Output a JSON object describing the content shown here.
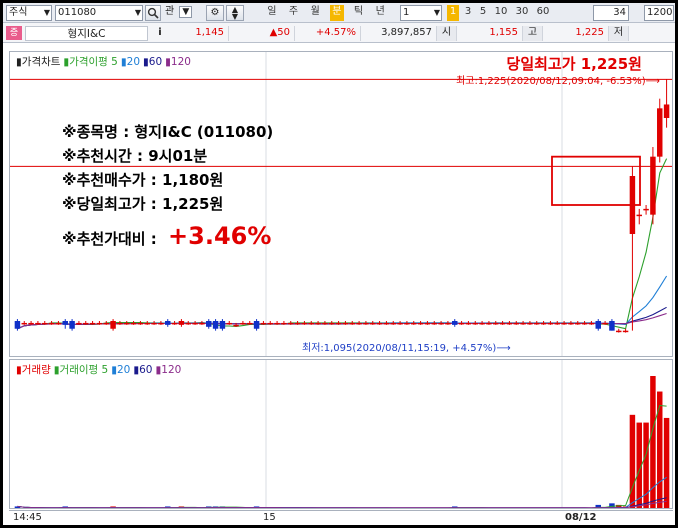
{
  "toolbar": {
    "market_select": "주식",
    "code_input": "011080",
    "search_icon": "search-icon",
    "gwan_button": "관",
    "period_buttons": [
      "일",
      "주",
      "월",
      "분",
      "틱",
      "년"
    ],
    "active_period": "분",
    "unit_value": "1",
    "interval_buttons": [
      "1",
      "3",
      "5",
      "10",
      "30",
      "60"
    ],
    "active_interval": "1",
    "count_value": "34",
    "range_value": "1200"
  },
  "quote": {
    "badge": "증",
    "name": "형지I&C",
    "info_button": "i",
    "price": "1,145",
    "change": "▲50",
    "change_rate": "+4.57%",
    "volume": "3,897,857",
    "open_label": "시",
    "open_value": "1,155",
    "high_label": "고",
    "high_value": "1,225",
    "low_label": "저"
  },
  "price_panel": {
    "legend": [
      {
        "text": "가격차트",
        "color": "#222222"
      },
      {
        "text": "가격이평 5",
        "color": "#2ca02c"
      },
      {
        "text": "20",
        "color": "#1f7fd6"
      },
      {
        "text": "60",
        "color": "#1a1a8c"
      },
      {
        "text": "120",
        "color": "#8b2c8b"
      }
    ],
    "headline": "당일최고가 1,225원",
    "high_marker": "최고:1,225(2020/08/12,09:04, -6.53%)⟶",
    "low_marker": "최저:1,095(2020/08/11,15:19, +4.57%)⟶",
    "info_lines": [
      "※종목명 : 형지I&C (011080)",
      "※추천시간 : 9시01분",
      "※추천매수가 : 1,180원",
      "※당일최고가 : 1,225원"
    ],
    "compare_label": "※추천가대비 :",
    "compare_value": "+3.46%"
  },
  "volume_panel": {
    "legend": [
      {
        "text": "거래량",
        "color": "#e00000"
      },
      {
        "text": "거래이평 5",
        "color": "#2ca02c"
      },
      {
        "text": "20",
        "color": "#1f7fd6"
      },
      {
        "text": "60",
        "color": "#1a1a8c"
      },
      {
        "text": "120",
        "color": "#8b2c8b"
      }
    ]
  },
  "x_axis": {
    "labels": [
      "14:45",
      "15",
      "08/12"
    ]
  },
  "chart_data": {
    "type": "candlestick",
    "candles": [
      {
        "o": 1100,
        "c": 1096,
        "h": 1101,
        "l": 1095
      },
      {
        "o": 1099,
        "c": 1099,
        "h": 1100,
        "l": 1098
      },
      {
        "o": 1099,
        "c": 1099,
        "h": 1100,
        "l": 1098
      },
      {
        "o": 1099,
        "c": 1099,
        "h": 1100,
        "l": 1098
      },
      {
        "o": 1099,
        "c": 1099,
        "h": 1100,
        "l": 1098
      },
      {
        "o": 1099,
        "c": 1099,
        "h": 1100,
        "l": 1098
      },
      {
        "o": 1099,
        "c": 1099,
        "h": 1100,
        "l": 1098
      },
      {
        "o": 1100,
        "c": 1098,
        "h": 1101,
        "l": 1096
      },
      {
        "o": 1100,
        "c": 1096,
        "h": 1101,
        "l": 1095
      },
      {
        "o": 1099,
        "c": 1099,
        "h": 1100,
        "l": 1098
      },
      {
        "o": 1099,
        "c": 1099,
        "h": 1100,
        "l": 1098
      },
      {
        "o": 1099,
        "c": 1099,
        "h": 1100,
        "l": 1098
      },
      {
        "o": 1099,
        "c": 1099,
        "h": 1100,
        "l": 1098
      },
      {
        "o": 1099,
        "c": 1099,
        "h": 1100,
        "l": 1098
      },
      {
        "o": 1096,
        "c": 1100,
        "h": 1101,
        "l": 1095
      },
      {
        "o": 1099,
        "c": 1099,
        "h": 1100,
        "l": 1098
      },
      {
        "o": 1099,
        "c": 1099,
        "h": 1100,
        "l": 1098
      },
      {
        "o": 1099,
        "c": 1099,
        "h": 1100,
        "l": 1098
      },
      {
        "o": 1099,
        "c": 1099,
        "h": 1100,
        "l": 1098
      },
      {
        "o": 1099,
        "c": 1099,
        "h": 1100,
        "l": 1098
      },
      {
        "o": 1099,
        "c": 1099,
        "h": 1100,
        "l": 1098
      },
      {
        "o": 1099,
        "c": 1099,
        "h": 1100,
        "l": 1098
      },
      {
        "o": 1100,
        "c": 1098,
        "h": 1101,
        "l": 1097
      },
      {
        "o": 1099,
        "c": 1099,
        "h": 1100,
        "l": 1098
      },
      {
        "o": 1098,
        "c": 1100,
        "h": 1101,
        "l": 1097
      },
      {
        "o": 1099,
        "c": 1099,
        "h": 1100,
        "l": 1098
      },
      {
        "o": 1099,
        "c": 1099,
        "h": 1100,
        "l": 1098
      },
      {
        "o": 1099,
        "c": 1099,
        "h": 1100,
        "l": 1098
      },
      {
        "o": 1100,
        "c": 1097,
        "h": 1101,
        "l": 1096
      },
      {
        "o": 1100,
        "c": 1096,
        "h": 1101,
        "l": 1095
      },
      {
        "o": 1100,
        "c": 1096,
        "h": 1101,
        "l": 1095
      },
      {
        "o": 1099,
        "c": 1099,
        "h": 1100,
        "l": 1098
      },
      {
        "o": 1098,
        "c": 1098,
        "h": 1099,
        "l": 1097
      },
      {
        "o": 1099,
        "c": 1099,
        "h": 1100,
        "l": 1098
      },
      {
        "o": 1099,
        "c": 1099,
        "h": 1100,
        "l": 1098
      },
      {
        "o": 1100,
        "c": 1096,
        "h": 1101,
        "l": 1095
      },
      {
        "o": 1099,
        "c": 1099,
        "h": 1100,
        "l": 1098
      },
      {
        "o": 1099,
        "c": 1099,
        "h": 1100,
        "l": 1098
      },
      {
        "o": 1099,
        "c": 1099,
        "h": 1100,
        "l": 1098
      },
      {
        "o": 1099,
        "c": 1099,
        "h": 1100,
        "l": 1098
      },
      {
        "o": 1099,
        "c": 1099,
        "h": 1100,
        "l": 1098
      },
      {
        "o": 1099,
        "c": 1099,
        "h": 1100,
        "l": 1098
      },
      {
        "o": 1099,
        "c": 1099,
        "h": 1100,
        "l": 1098
      },
      {
        "o": 1099,
        "c": 1099,
        "h": 1100,
        "l": 1098
      },
      {
        "o": 1099,
        "c": 1099,
        "h": 1100,
        "l": 1098
      },
      {
        "o": 1099,
        "c": 1099,
        "h": 1100,
        "l": 1098
      },
      {
        "o": 1099,
        "c": 1099,
        "h": 1100,
        "l": 1098
      },
      {
        "o": 1099,
        "c": 1099,
        "h": 1100,
        "l": 1098
      },
      {
        "o": 1099,
        "c": 1099,
        "h": 1100,
        "l": 1098
      },
      {
        "o": 1099,
        "c": 1099,
        "h": 1100,
        "l": 1098
      },
      {
        "o": 1099,
        "c": 1099,
        "h": 1100,
        "l": 1098
      },
      {
        "o": 1099,
        "c": 1099,
        "h": 1100,
        "l": 1098
      },
      {
        "o": 1099,
        "c": 1099,
        "h": 1100,
        "l": 1098
      },
      {
        "o": 1099,
        "c": 1099,
        "h": 1100,
        "l": 1098
      },
      {
        "o": 1099,
        "c": 1099,
        "h": 1100,
        "l": 1098
      },
      {
        "o": 1099,
        "c": 1099,
        "h": 1100,
        "l": 1098
      },
      {
        "o": 1099,
        "c": 1099,
        "h": 1100,
        "l": 1098
      },
      {
        "o": 1099,
        "c": 1099,
        "h": 1100,
        "l": 1098
      },
      {
        "o": 1099,
        "c": 1099,
        "h": 1100,
        "l": 1098
      },
      {
        "o": 1099,
        "c": 1099,
        "h": 1100,
        "l": 1098
      },
      {
        "o": 1099,
        "c": 1099,
        "h": 1100,
        "l": 1098
      },
      {
        "o": 1099,
        "c": 1099,
        "h": 1100,
        "l": 1098
      },
      {
        "o": 1099,
        "c": 1099,
        "h": 1100,
        "l": 1098
      },
      {
        "o": 1099,
        "c": 1099,
        "h": 1100,
        "l": 1098
      },
      {
        "o": 1100,
        "c": 1098,
        "h": 1101,
        "l": 1097
      },
      {
        "o": 1099,
        "c": 1099,
        "h": 1100,
        "l": 1098
      },
      {
        "o": 1099,
        "c": 1099,
        "h": 1100,
        "l": 1098
      },
      {
        "o": 1099,
        "c": 1099,
        "h": 1100,
        "l": 1098
      },
      {
        "o": 1099,
        "c": 1099,
        "h": 1100,
        "l": 1098
      },
      {
        "o": 1099,
        "c": 1099,
        "h": 1100,
        "l": 1098
      },
      {
        "o": 1099,
        "c": 1099,
        "h": 1100,
        "l": 1098
      },
      {
        "o": 1099,
        "c": 1099,
        "h": 1100,
        "l": 1098
      },
      {
        "o": 1099,
        "c": 1099,
        "h": 1100,
        "l": 1098
      },
      {
        "o": 1099,
        "c": 1099,
        "h": 1100,
        "l": 1098
      },
      {
        "o": 1099,
        "c": 1099,
        "h": 1100,
        "l": 1098
      },
      {
        "o": 1099,
        "c": 1099,
        "h": 1100,
        "l": 1098
      },
      {
        "o": 1099,
        "c": 1099,
        "h": 1100,
        "l": 1098
      },
      {
        "o": 1099,
        "c": 1099,
        "h": 1100,
        "l": 1098
      },
      {
        "o": 1099,
        "c": 1099,
        "h": 1100,
        "l": 1098
      },
      {
        "o": 1099,
        "c": 1099,
        "h": 1100,
        "l": 1098
      },
      {
        "o": 1099,
        "c": 1099,
        "h": 1100,
        "l": 1098
      },
      {
        "o": 1099,
        "c": 1099,
        "h": 1100,
        "l": 1098
      },
      {
        "o": 1099,
        "c": 1099,
        "h": 1100,
        "l": 1098
      },
      {
        "o": 1099,
        "c": 1099,
        "h": 1100,
        "l": 1098
      },
      {
        "o": 1099,
        "c": 1099,
        "h": 1100,
        "l": 1098
      },
      {
        "o": 1100,
        "c": 1096,
        "h": 1101,
        "l": 1095
      },
      {
        "o": 1099,
        "c": 1099,
        "h": 1100,
        "l": 1098
      },
      {
        "o": 1100,
        "c": 1095,
        "h": 1101,
        "l": 1095
      },
      {
        "o": 1095,
        "c": 1095,
        "h": 1096,
        "l": 1094
      },
      {
        "o": 1095,
        "c": 1095,
        "h": 1096,
        "l": 1094
      },
      {
        "o": 1145,
        "c": 1175,
        "h": 1180,
        "l": 1095
      },
      {
        "o": 1155,
        "c": 1155,
        "h": 1158,
        "l": 1150
      },
      {
        "o": 1158,
        "c": 1158,
        "h": 1160,
        "l": 1155
      },
      {
        "o": 1155,
        "c": 1185,
        "h": 1190,
        "l": 1150
      },
      {
        "o": 1185,
        "c": 1210,
        "h": 1215,
        "l": 1182
      },
      {
        "o": 1205,
        "c": 1212,
        "h": 1225,
        "l": 1200
      }
    ],
    "volumes": [
      1,
      0,
      0,
      0,
      0,
      0,
      0,
      1,
      0,
      0,
      0,
      0,
      0,
      0,
      1,
      0,
      0,
      0,
      0,
      0,
      0,
      0,
      1,
      0,
      1,
      0,
      0,
      0,
      1,
      1,
      1,
      0,
      0,
      0,
      0,
      1,
      0,
      0,
      0,
      0,
      0,
      0,
      0,
      0,
      0,
      0,
      0,
      0,
      0,
      0,
      0,
      0,
      0,
      0,
      0,
      0,
      0,
      0,
      0,
      0,
      0,
      0,
      0,
      0,
      1,
      0,
      0,
      0,
      0,
      0,
      0,
      0,
      0,
      0,
      0,
      0,
      0,
      0,
      0,
      0,
      0,
      0,
      0,
      0,
      0,
      2,
      0,
      3,
      2,
      1,
      60,
      55,
      55,
      85,
      75,
      58
    ],
    "yrange": [
      1085,
      1235
    ]
  }
}
